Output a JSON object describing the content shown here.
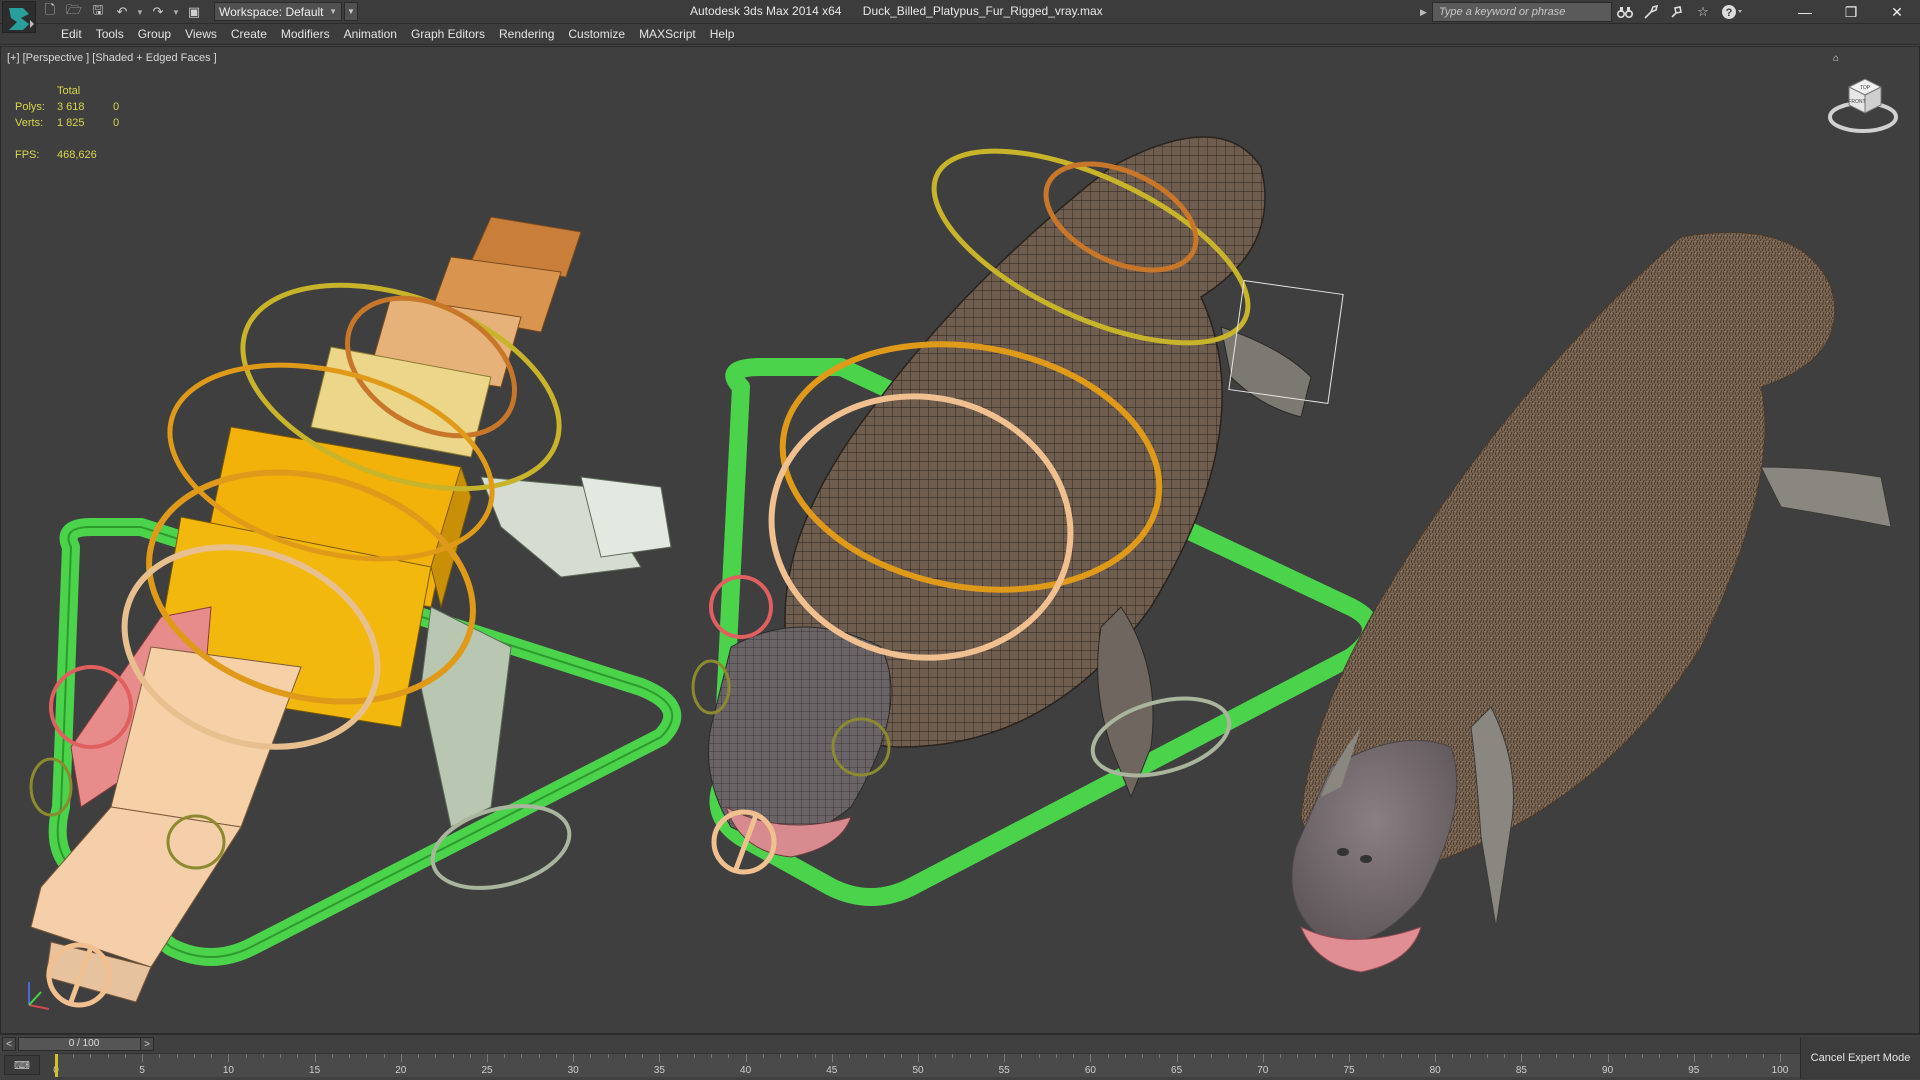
{
  "app": {
    "title": "Autodesk 3ds Max  2014 x64",
    "file": "Duck_Billed_Platypus_Fur_Rigged_vray.max"
  },
  "workspace": {
    "label": "Workspace: Default"
  },
  "search": {
    "placeholder": "Type a keyword or phrase"
  },
  "menu": [
    "Edit",
    "Tools",
    "Group",
    "Views",
    "Create",
    "Modifiers",
    "Animation",
    "Graph Editors",
    "Rendering",
    "Customize",
    "MAXScript",
    "Help"
  ],
  "viewport": {
    "label": "[+] [Perspective ] [Shaded + Edged Faces ]",
    "stats": {
      "header": "Total",
      "polys_label": "Polys:",
      "polys_total": "3 618",
      "polys_sel": "0",
      "verts_label": "Verts:",
      "verts_total": "1 825",
      "verts_sel": "0",
      "fps_label": "FPS:",
      "fps_value": "468,626"
    },
    "viewcube": {
      "top": "TOP",
      "front": "FRONT"
    }
  },
  "timeline": {
    "slider_label": "0 / 100",
    "current_frame": 0,
    "start": 0,
    "end": 100,
    "ticks": [
      "0",
      "5",
      "10",
      "15",
      "20",
      "25",
      "30",
      "35",
      "40",
      "45",
      "50",
      "55",
      "60",
      "65",
      "70",
      "75",
      "80",
      "85",
      "90",
      "95",
      "100"
    ],
    "cancel_expert_label": "Cancel Expert Mode"
  },
  "icons": {
    "logo": "3ds-max-logo-icon",
    "new": "new-file-icon",
    "open": "open-file-icon",
    "save": "save-file-icon",
    "undo": "undo-icon",
    "redo": "redo-icon",
    "project": "project-folder-icon",
    "binoculars": "search-binoculars-icon",
    "subscription": "subscription-icon",
    "communication": "communication-center-icon",
    "favorites": "favorites-star-icon",
    "help": "help-icon"
  },
  "colors": {
    "stats_text": "#d9d64a",
    "viewport_bg": "#3f3f3f",
    "control_green": "#4bd34b",
    "control_orange": "#e09a1a",
    "control_yellow": "#c8b42a",
    "control_red": "#e06060",
    "fur_brown": "#7a6552"
  }
}
